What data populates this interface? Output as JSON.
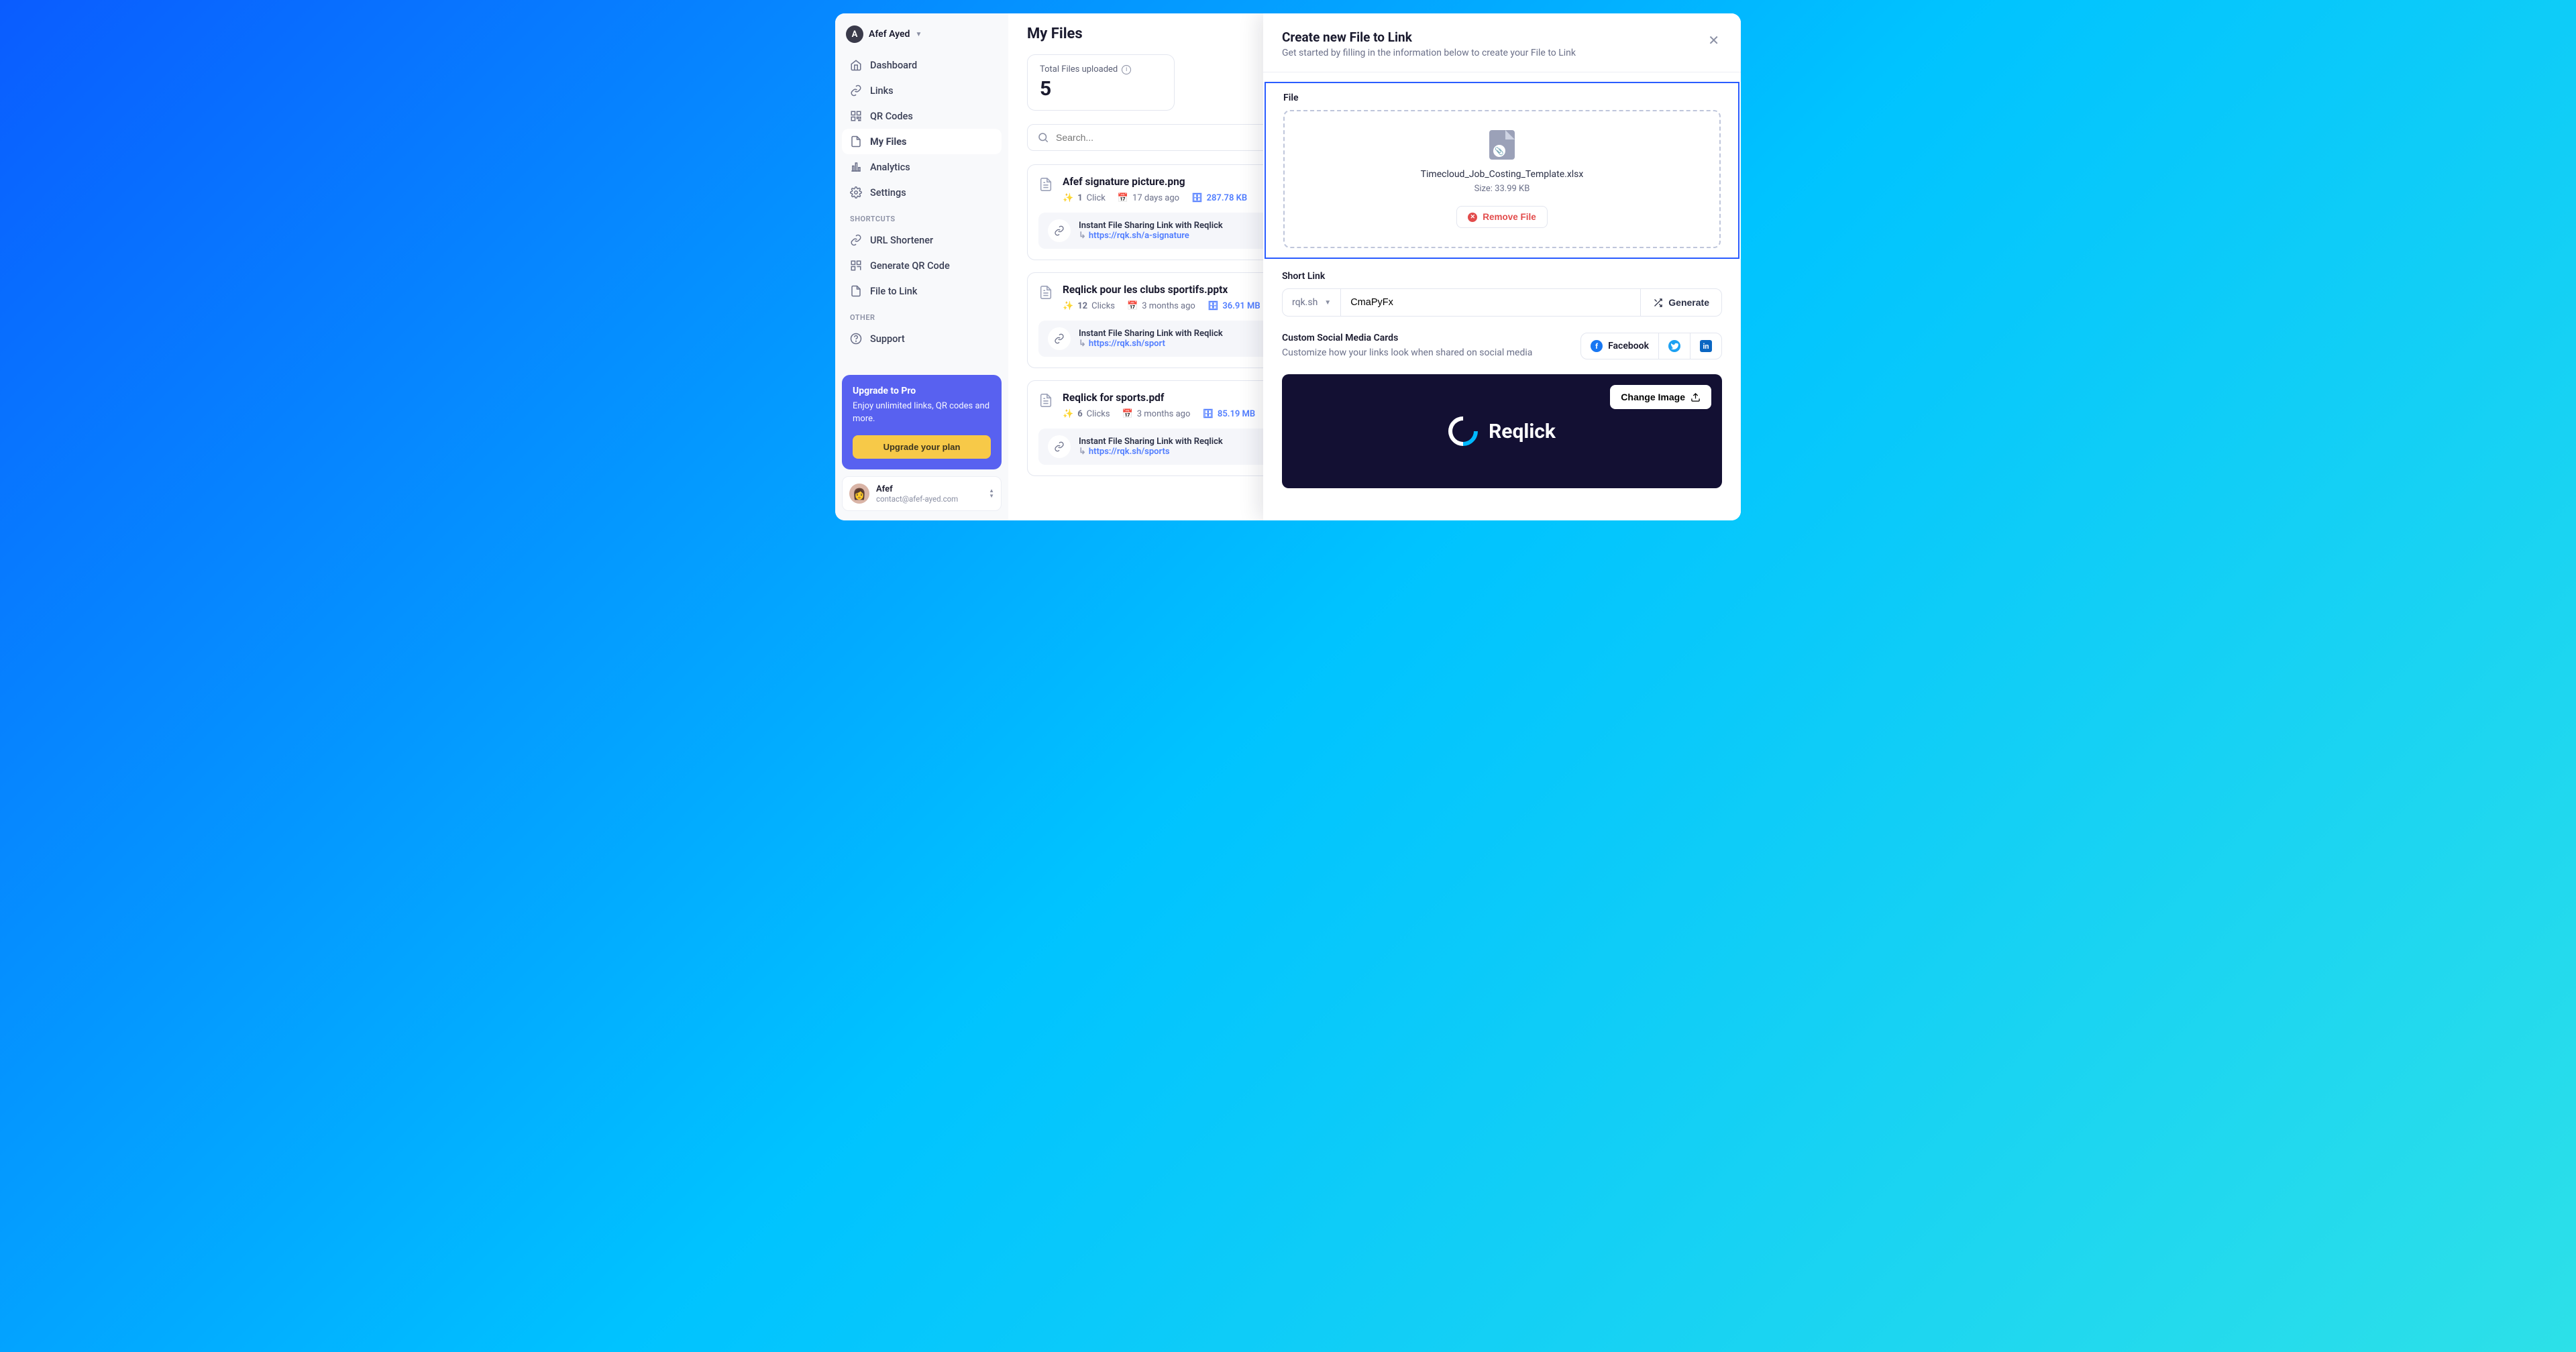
{
  "user": {
    "initial": "A",
    "name": "Afef Ayed"
  },
  "nav": {
    "dashboard": "Dashboard",
    "links": "Links",
    "qrcodes": "QR Codes",
    "myfiles": "My Files",
    "analytics": "Analytics",
    "settings": "Settings"
  },
  "section_shortcuts": "SHORTCUTS",
  "shortcuts": {
    "url": "URL Shortener",
    "qr": "Generate QR Code",
    "ftl": "File to Link"
  },
  "section_other": "OTHER",
  "other": {
    "support": "Support"
  },
  "upgrade": {
    "title": "Upgrade to Pro",
    "desc": "Enjoy unlimited links, QR codes and more.",
    "button": "Upgrade your plan"
  },
  "footer_user": {
    "name": "Afef",
    "email": "contact@afef-ayed.com"
  },
  "page_title": "My Files",
  "stat": {
    "label": "Total Files uploaded",
    "value": "5"
  },
  "search_placeholder": "Search...",
  "files": [
    {
      "title": "Afef signature picture.png",
      "clicks": "1",
      "clicks_word": "Click",
      "date": "17 days ago",
      "size": "287.78 KB",
      "link_label": "Instant File Sharing Link with Reqlick",
      "url": "https://rqk.sh/a-signature"
    },
    {
      "title": "Reqlick pour les clubs sportifs.pptx",
      "clicks": "12",
      "clicks_word": "Clicks",
      "date": "3 months ago",
      "size": "36.91 MB",
      "link_label": "Instant File Sharing Link with Reqlick",
      "url": "https://rqk.sh/sport"
    },
    {
      "title": "Reqlick for sports.pdf",
      "clicks": "6",
      "clicks_word": "Clicks",
      "date": "3 months ago",
      "size": "85.19 MB",
      "link_label": "Instant File Sharing Link with Reqlick",
      "url": "https://rqk.sh/sports"
    }
  ],
  "panel": {
    "title": "Create new File to Link",
    "subtitle": "Get started by filling in the information below to create your File to Link",
    "file_label": "File",
    "uploaded_filename": "Timecloud_Job_Costing_Template.xlsx",
    "uploaded_size": "Size: 33.99 KB",
    "remove": "Remove File",
    "shortlink_label": "Short Link",
    "domain": "rqk.sh",
    "slug": "CmaPyFx",
    "generate": "Generate",
    "social_title": "Custom Social Media Cards",
    "social_desc": "Customize how your links look when shared on social media",
    "tab_fb": "Facebook",
    "change_image": "Change Image",
    "logo_text": "Reqlick"
  }
}
